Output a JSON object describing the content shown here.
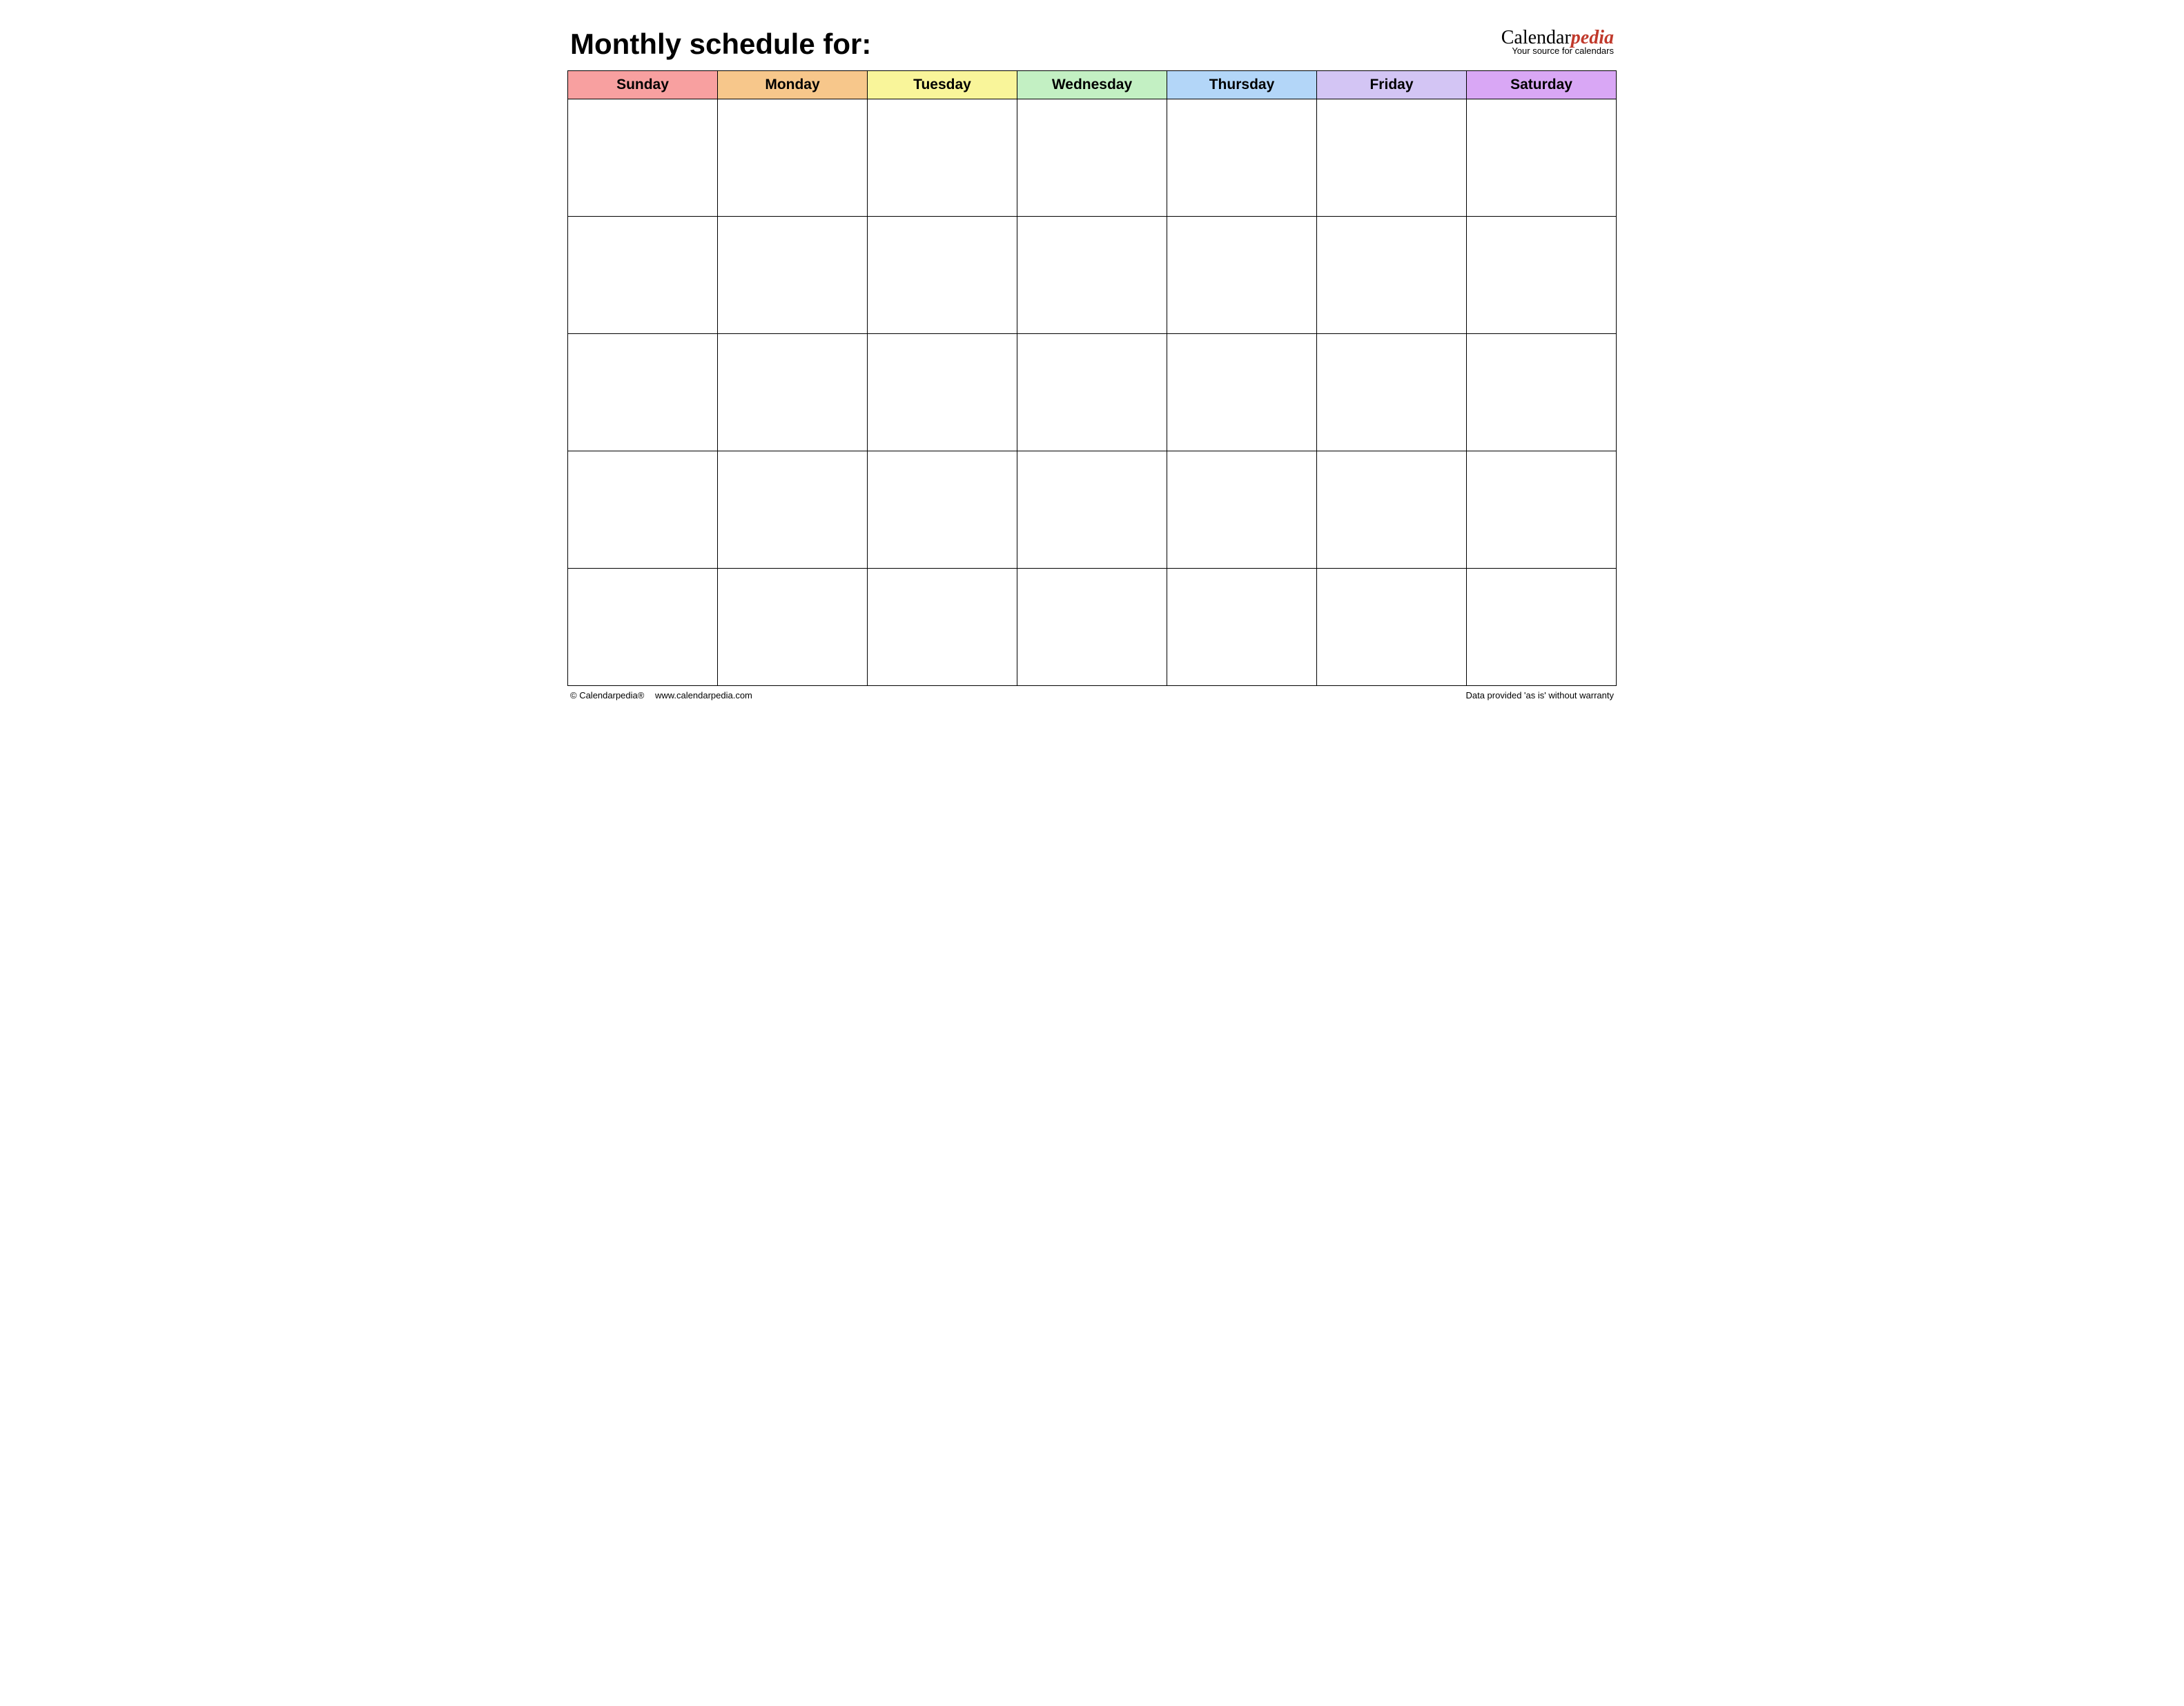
{
  "header": {
    "title": "Monthly schedule for:",
    "brand_prefix": "Calendar",
    "brand_suffix": "pedia",
    "brand_tagline": "Your source for calendars"
  },
  "days": {
    "sun": "Sunday",
    "mon": "Monday",
    "tue": "Tuesday",
    "wed": "Wednesday",
    "thu": "Thursday",
    "fri": "Friday",
    "sat": "Saturday"
  },
  "colors": {
    "sun": "#f8a0a0",
    "mon": "#f7c78b",
    "tue": "#f9f59a",
    "wed": "#c3f0c3",
    "thu": "#b3d6f8",
    "fri": "#d3c5f4",
    "sat": "#d9a7f5"
  },
  "grid": {
    "rows": 5,
    "cols": 7
  },
  "footer": {
    "copyright": "© Calendarpedia®",
    "website": "www.calendarpedia.com",
    "disclaimer": "Data provided 'as is' without warranty"
  }
}
